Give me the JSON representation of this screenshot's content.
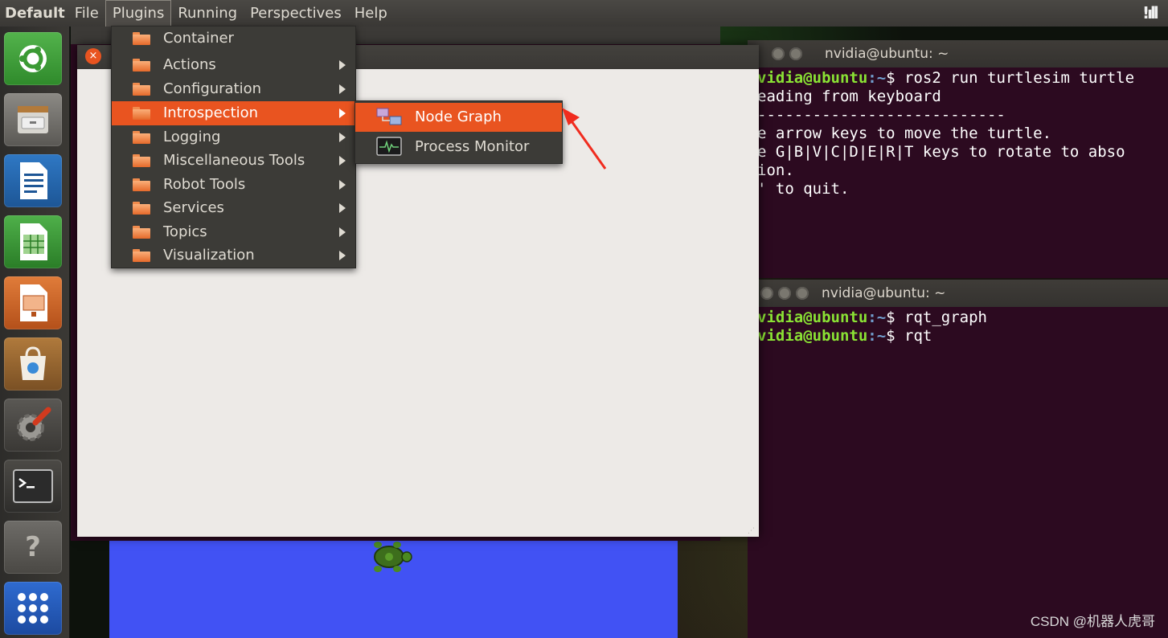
{
  "menubar": {
    "app_name": "Default",
    "items": [
      "File",
      "Plugins",
      "Running",
      "Perspectives",
      "Help"
    ]
  },
  "launcher": {
    "icons": [
      "ubuntu-dash-icon",
      "files-icon",
      "writer-icon",
      "calc-icon",
      "impress-icon",
      "software-center-icon",
      "system-settings-icon",
      "terminal-icon",
      "help-icon",
      "show-apps-icon"
    ]
  },
  "plugins_menu": {
    "items": [
      {
        "label": "Container",
        "submenu": false
      },
      {
        "label": "Actions",
        "submenu": true
      },
      {
        "label": "Configuration",
        "submenu": true
      },
      {
        "label": "Introspection",
        "submenu": true
      },
      {
        "label": "Logging",
        "submenu": true
      },
      {
        "label": "Miscellaneous Tools",
        "submenu": true
      },
      {
        "label": "Robot Tools",
        "submenu": true
      },
      {
        "label": "Services",
        "submenu": true
      },
      {
        "label": "Topics",
        "submenu": true
      },
      {
        "label": "Visualization",
        "submenu": true
      }
    ],
    "highlighted": "Introspection"
  },
  "introspection_submenu": {
    "items": [
      {
        "label": "Node Graph"
      },
      {
        "label": "Process Monitor"
      }
    ],
    "highlighted": "Node Graph"
  },
  "terminal1": {
    "title": "nvidia@ubuntu: ~",
    "lines": [
      {
        "prompt": "vidia@ubuntu",
        "path": ":~",
        "cmd": "$ ros2 run turtlesim turtle"
      },
      {
        "text": "eading from keyboard"
      },
      {
        "text": "---------------------------"
      },
      {
        "text": "e arrow keys to move the turtle."
      },
      {
        "text": "e G|B|V|C|D|E|R|T keys to rotate to abso"
      },
      {
        "text": "ion."
      },
      {
        "text": "' to quit."
      }
    ]
  },
  "terminal2": {
    "title": "nvidia@ubuntu: ~",
    "lines": [
      {
        "prompt": "vidia@ubuntu",
        "path": ":~",
        "cmd": "$ rqt_graph"
      },
      {
        "prompt": "vidia@ubuntu",
        "path": ":~",
        "cmd": "$ rqt"
      }
    ]
  },
  "rqt_window": {
    "close_glyph": "×"
  },
  "watermark": "CSDN @机器人虎哥",
  "colors": {
    "accent": "#e95420",
    "terminal_bg": "#2c0a20",
    "turtlesim_bg": "#4152f4",
    "prompt_green": "#8ae234",
    "menu_bg": "#3c3b37"
  }
}
